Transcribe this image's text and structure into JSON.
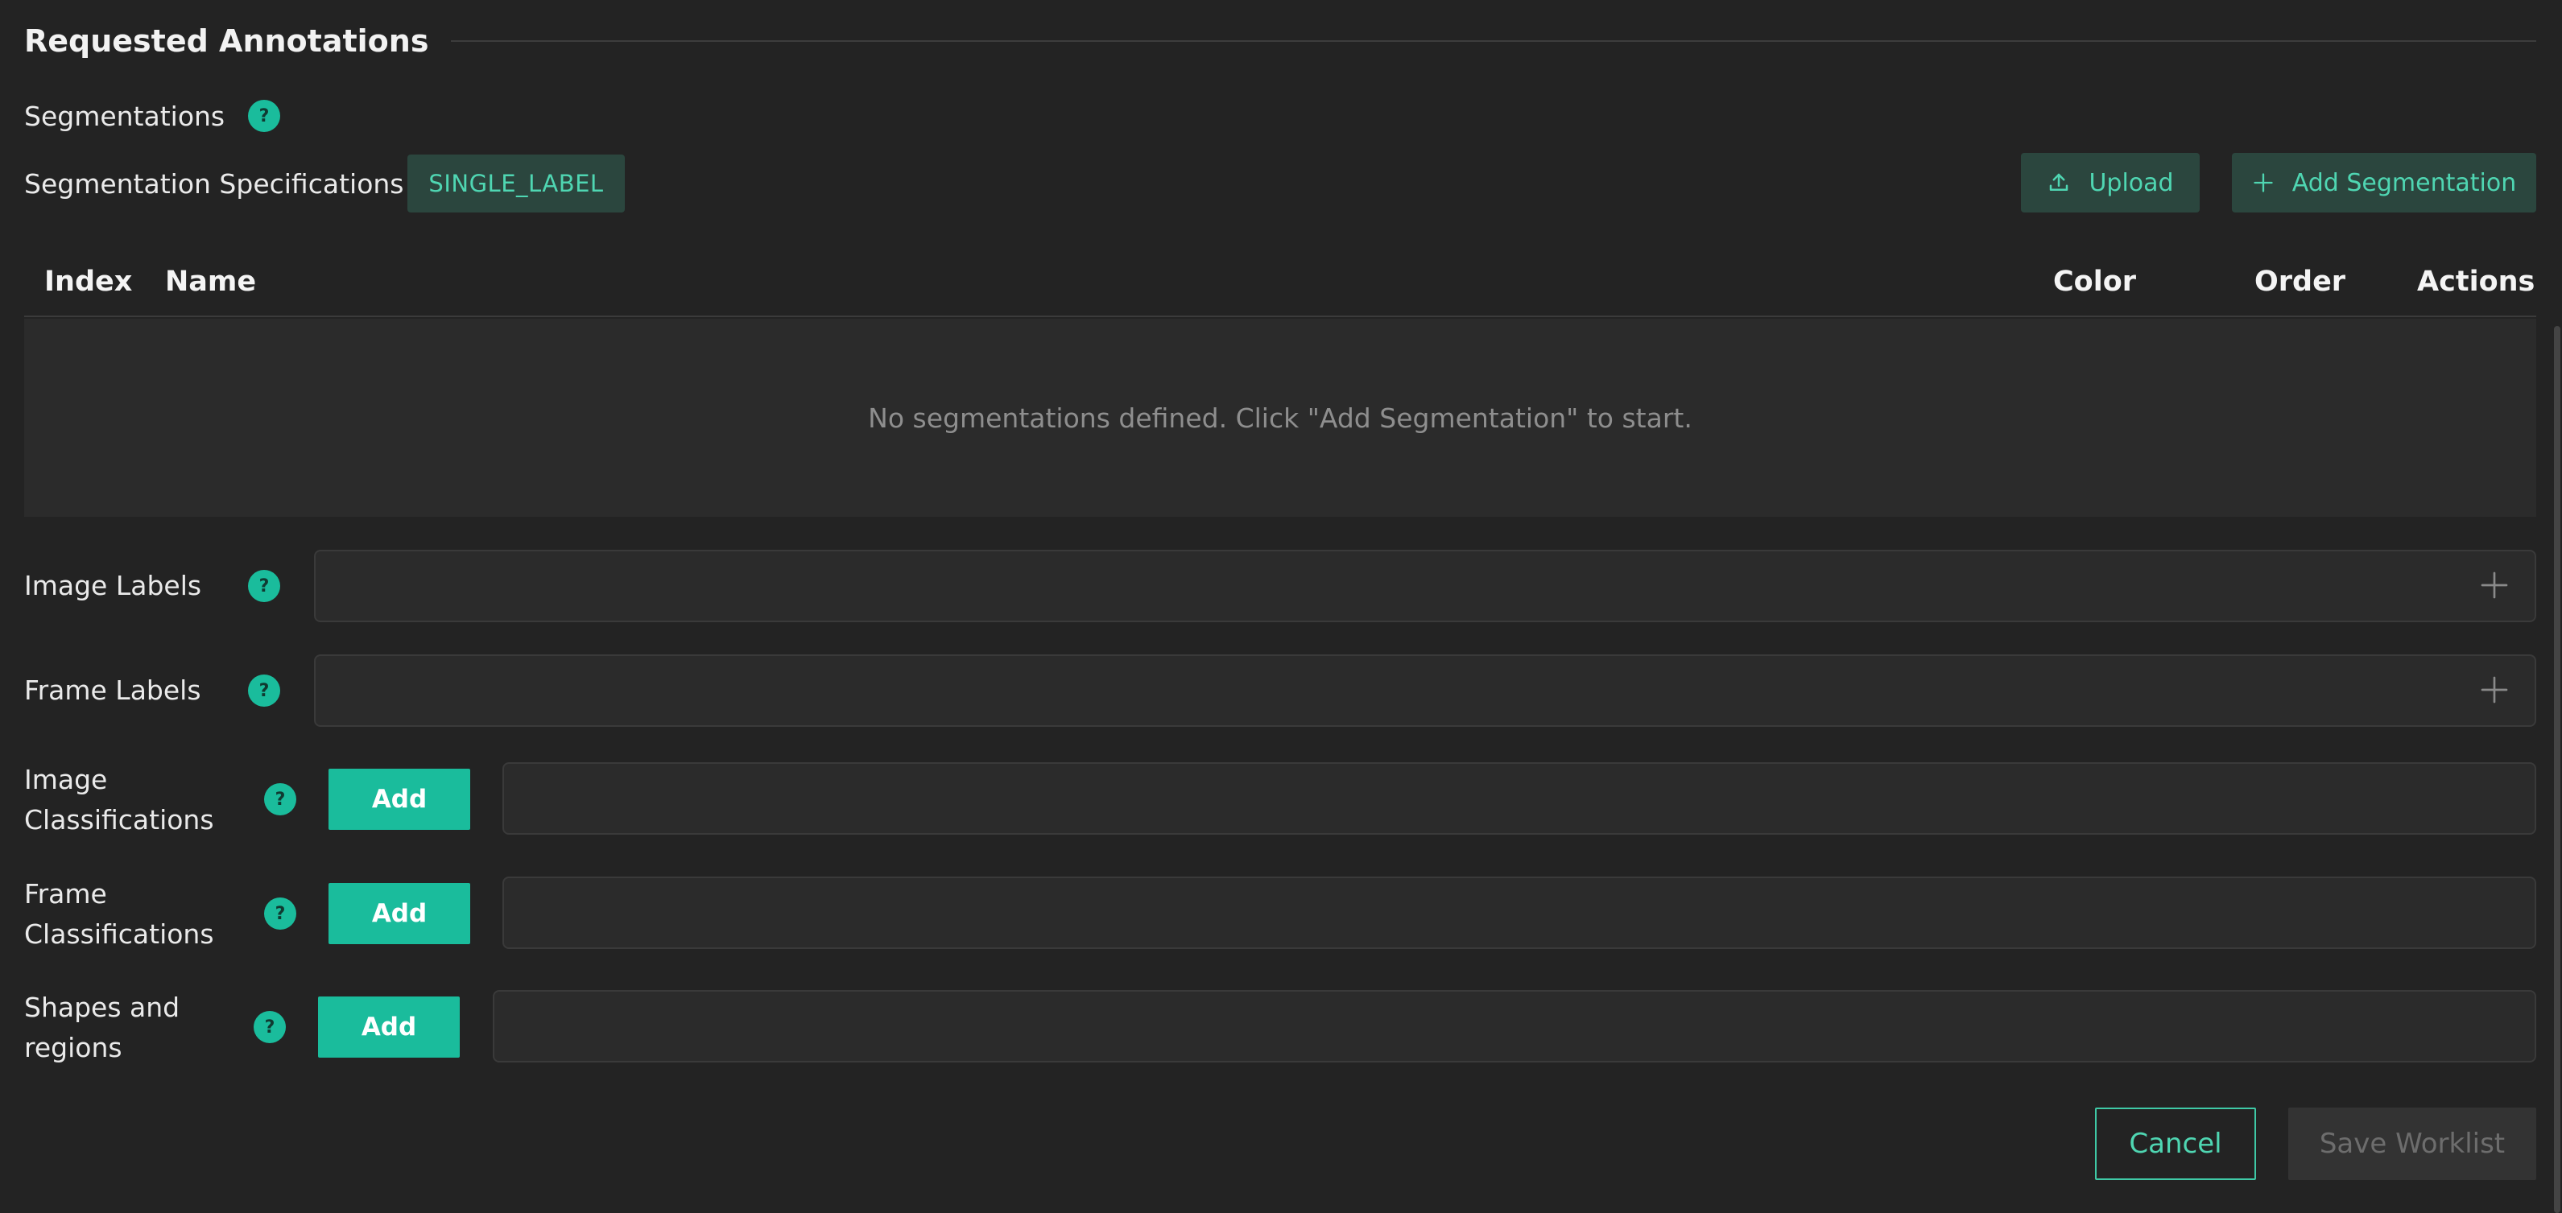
{
  "section": {
    "title": "Requested Annotations"
  },
  "segmentations": {
    "label": "Segmentations",
    "spec_label": "Segmentation Specifications",
    "spec_value": "SINGLE_LABEL",
    "upload_label": "Upload",
    "add_label": "Add Segmentation",
    "table": {
      "columns": [
        "Index",
        "Name",
        "Color",
        "Order",
        "Actions"
      ],
      "empty_message": "No segmentations defined. Click \"Add Segmentation\" to start."
    }
  },
  "image_labels": {
    "label": "Image Labels"
  },
  "frame_labels": {
    "label": "Frame Labels"
  },
  "image_classifications": {
    "label": "Image Classifications",
    "add_label": "Add"
  },
  "frame_classifications": {
    "label": "Frame Classifications",
    "add_label": "Add"
  },
  "shapes_regions": {
    "label": "Shapes and regions",
    "add_label": "Add"
  },
  "help": {
    "glyph": "?"
  },
  "footer": {
    "cancel_label": "Cancel",
    "save_label": "Save Worklist"
  },
  "colors": {
    "background": "#232323",
    "accent": "#1abc9c",
    "accent_text": "#4fd6b2",
    "muted_button": "#2b463e"
  }
}
